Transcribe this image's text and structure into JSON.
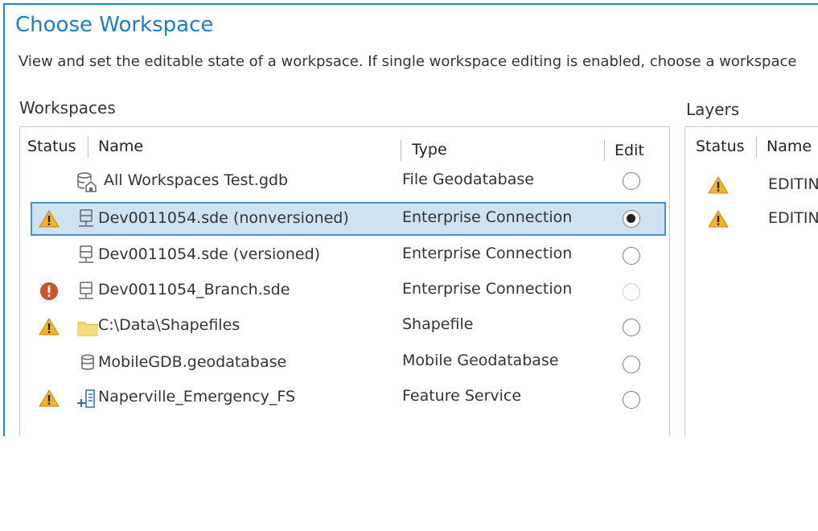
{
  "dialog": {
    "title": "Choose Workspace",
    "description": "View and set the editable state of a workpsace.  If single workspace editing is enabled, choose a workspace"
  },
  "workspaces": {
    "label": "Workspaces",
    "columns": {
      "status": "Status",
      "name": "Name",
      "type": "Type",
      "edit": "Edit"
    },
    "rows": [
      {
        "status": "none",
        "icon": "gdb-file-icon",
        "name": "All Workspaces Test.gdb",
        "type": "File Geodatabase",
        "edit": "unchecked",
        "selected": false
      },
      {
        "status": "warning",
        "icon": "server-icon",
        "name": "Dev0011054.sde (nonversioned)",
        "type": "Enterprise Connection",
        "edit": "checked",
        "selected": true
      },
      {
        "status": "none",
        "icon": "server-icon",
        "name": "Dev0011054.sde (versioned)",
        "type": "Enterprise Connection",
        "edit": "unchecked",
        "selected": false
      },
      {
        "status": "error",
        "icon": "server-icon",
        "name": "Dev0011054_Branch.sde",
        "type": "Enterprise Connection",
        "edit": "disabled",
        "selected": false
      },
      {
        "status": "warning",
        "icon": "folder-icon",
        "name": "C:\\Data\\Shapefiles",
        "type": "Shapefile",
        "edit": "unchecked",
        "selected": false
      },
      {
        "status": "none",
        "icon": "database-icon",
        "name": "MobileGDB.geodatabase",
        "type": "Mobile Geodatabase",
        "edit": "unchecked",
        "selected": false
      },
      {
        "status": "warning",
        "icon": "feature-service-icon",
        "name": "Naperville_Emergency_FS",
        "type": "Feature Service",
        "edit": "unchecked",
        "selected": false
      }
    ]
  },
  "layers": {
    "label": "Layers",
    "columns": {
      "status": "Status",
      "name": "Name"
    },
    "rows": [
      {
        "status": "warning",
        "name": "EDITIN"
      },
      {
        "status": "warning",
        "name": "EDITIN"
      }
    ]
  },
  "colors": {
    "accent": "#1a7fc6",
    "selection_bg": "#cfe2f1",
    "selection_border": "#4d8fcc",
    "warning": "#f2b32b",
    "error": "#c9562c"
  }
}
